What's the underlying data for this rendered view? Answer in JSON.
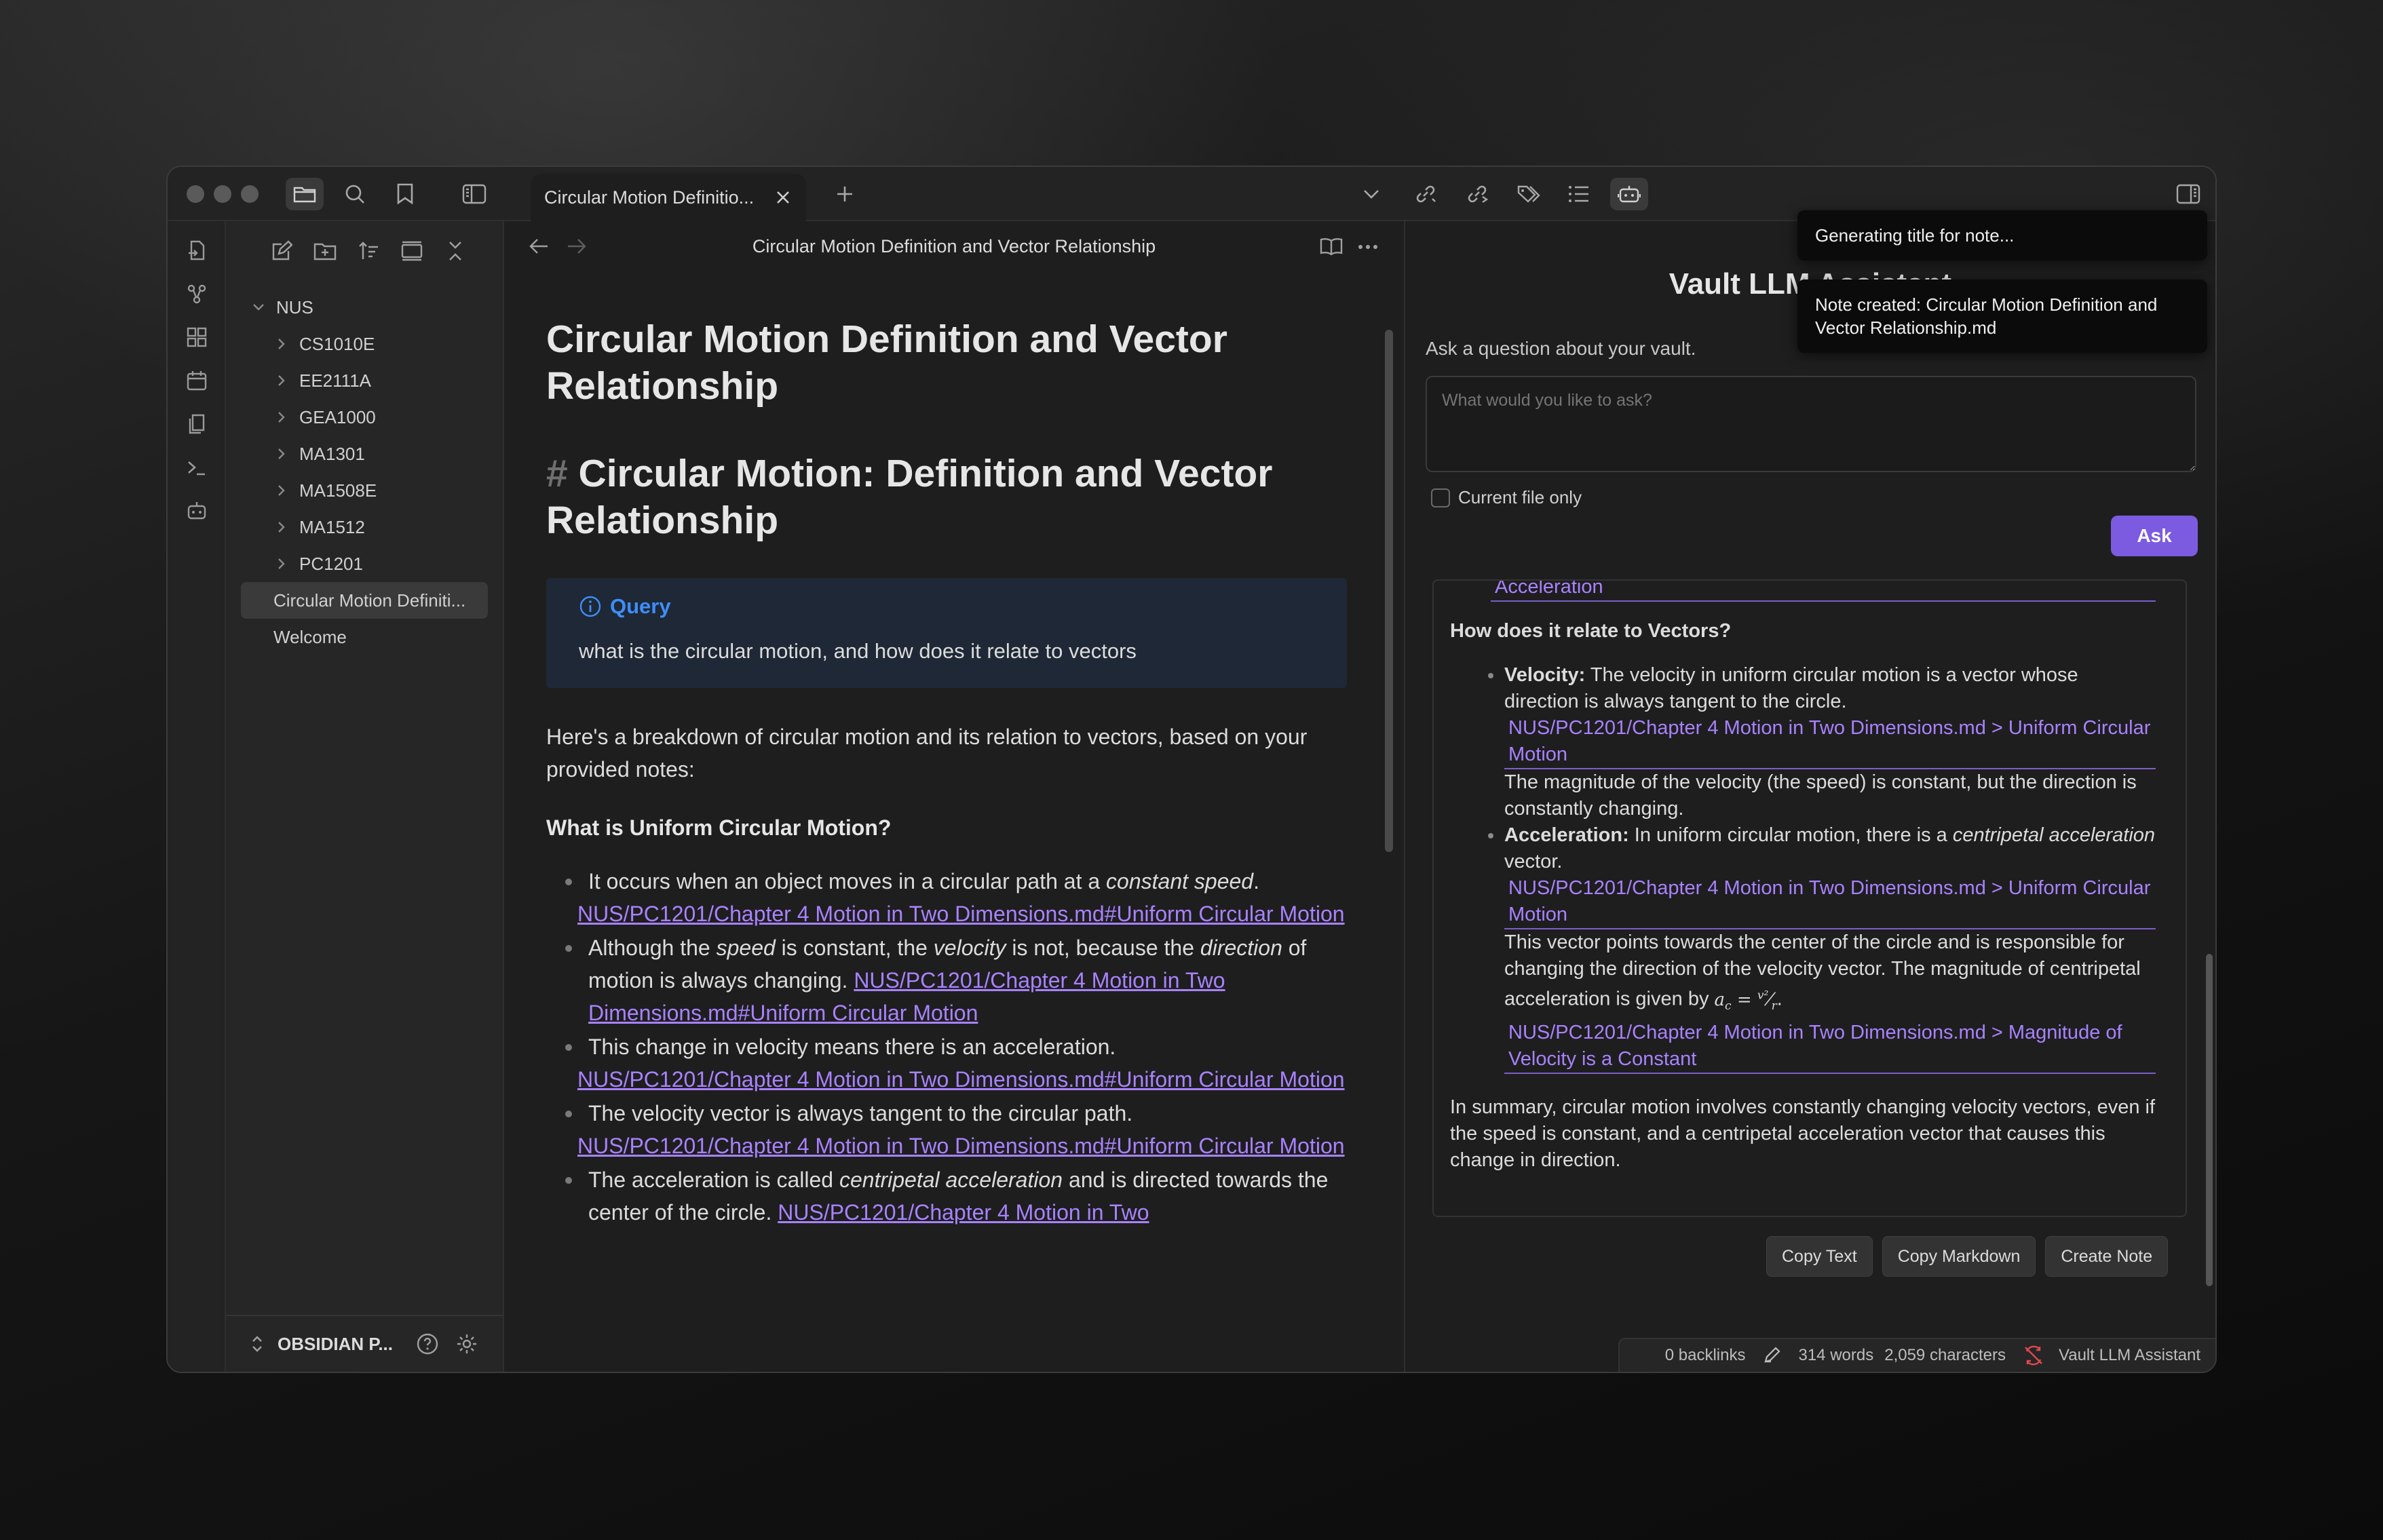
{
  "titlebar": {
    "tab_title": "Circular Motion Definition and Vector Relationship",
    "tab_label_truncated": "Circular Motion Definitio..."
  },
  "sidebar": {
    "vault_root": "NUS",
    "folders": [
      "CS1010E",
      "EE2111A",
      "GEA1000",
      "MA1301",
      "MA1508E",
      "MA1512",
      "PC1201"
    ],
    "files": [
      "Circular Motion Definiti...",
      "Welcome"
    ],
    "vault_name": "OBSIDIAN P..."
  },
  "editor": {
    "header_title": "Circular Motion Definition and Vector Relationship",
    "inline_title": "Circular Motion Definition and Vector Relationship",
    "h1_hash": "#",
    "h1_text": "Circular Motion: Definition and Vector Relationship",
    "callout_title": "Query",
    "callout_body": "what is the circular motion, and how does it relate to vectors",
    "intro": "Here's a breakdown of circular motion and its relation to vectors, based on your provided notes:",
    "section_heading": "What is Uniform Circular Motion?",
    "bullets": {
      "b1_text": "It occurs when an object moves in a circular path at a",
      "b1_em": "constant speed",
      "b1_end": ".",
      "b1_link": "NUS/PC1201/Chapter 4 Motion in Two Dimensions.md#Uniform Circular Motion",
      "b2_a": "Although the",
      "b2_em1": "speed",
      "b2_b": "is constant, the",
      "b2_em2": "velocity",
      "b2_c": "is not, because the",
      "b2_em3": "direction",
      "b2_d": "of motion is always changing.",
      "b2_link": "NUS/PC1201/Chapter 4 Motion in Two Dimensions.md#Uniform Circular Motion",
      "b3_text": "This change in velocity means there is an acceleration.",
      "b3_link": "NUS/PC1201/Chapter 4 Motion in Two Dimensions.md#Uniform Circular Motion",
      "b4_text": "The velocity vector is always tangent to the circular path.",
      "b4_link": "NUS/PC1201/Chapter 4 Motion in Two Dimensions.md#Uniform Circular Motion",
      "b5_a": "The acceleration is called",
      "b5_em": "centripetal acceleration",
      "b5_b": "and is directed towards the center of the circle.",
      "b5_link": "NUS/PC1201/Chapter 4 Motion in Two"
    }
  },
  "assistant": {
    "heading": "Vault LLM Assistant",
    "subheading": "Ask a question about your vault.",
    "input_placeholder": "What would you like to ask?",
    "checkbox_label": "Current file only",
    "ask_button": "Ask",
    "answer": {
      "top_link": "Acceleration",
      "vectors_heading": "How does it relate to Vectors?",
      "vel_label": "Velocity:",
      "vel_text": "The velocity in uniform circular motion is a vector whose direction is always tangent to the circle.",
      "vel_link": "NUS/PC1201/Chapter 4 Motion in Two Dimensions.md > Uniform Circular Motion",
      "vel_more": "The magnitude of the velocity (the speed) is constant, but the direction is constantly changing.",
      "acc_label": "Acceleration:",
      "acc_text_a": "In uniform circular motion, there is a",
      "acc_em": "centripetal acceleration",
      "acc_text_b": "vector.",
      "acc_link": "NUS/PC1201/Chapter 4 Motion in Two Dimensions.md > Uniform Circular Motion",
      "acc_more": "This vector points towards the center of the circle and is responsible for changing the direction of the velocity vector. The magnitude of centripetal acceleration is given by",
      "acc_link2": "NUS/PC1201/Chapter 4 Motion in Two Dimensions.md > Magnitude of Velocity is a Constant",
      "summary": "In summary, circular motion involves constantly changing velocity vectors, even if the speed is constant, and a centripetal acceleration vector that causes this change in direction."
    },
    "buttons": [
      "Copy Text",
      "Copy Markdown",
      "Create Note"
    ]
  },
  "statusbar": {
    "backlinks": "0 backlinks",
    "words": "314 words",
    "characters": "2,059 characters",
    "plugin": "Vault LLM Assistant"
  },
  "toasts": {
    "generating": "Generating title for note...",
    "created": "Note created: Circular Motion Definition and Vector Relationship.md"
  },
  "colors": {
    "accent": "#7c5be0",
    "link": "#a882ff",
    "callout": "#3e8ef7",
    "background": "#1e1e1e"
  }
}
